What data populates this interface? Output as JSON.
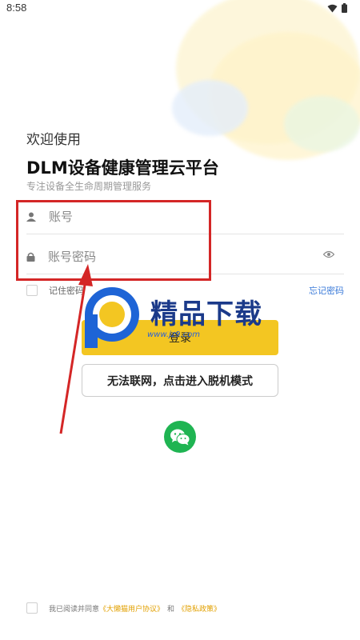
{
  "status_bar": {
    "time": "8:58"
  },
  "header": {
    "welcome": "欢迎使用",
    "title": "DLM设备健康管理云平台",
    "subtitle": "专注设备全生命周期管理服务"
  },
  "form": {
    "account_placeholder": "账号",
    "password_placeholder": "账号密码",
    "remember_label": "记住密码",
    "forgot_label": "忘记密码",
    "login_label": "登录",
    "offline_label": "无法联网，点击进入脱机模式"
  },
  "agreement": {
    "prefix": "我已阅读并同意",
    "user_agreement": "《大懒猫用户协议》",
    "and": "和",
    "privacy_policy": "《隐私政策》"
  },
  "watermark": {
    "text": "精品下载",
    "url": "www.jz9.com"
  },
  "colors": {
    "accent": "#f3c622",
    "link": "#3a7ad9",
    "wechat": "#1fb452",
    "annotation": "#d42626"
  },
  "icons": [
    "wifi-icon",
    "battery-icon",
    "user-icon",
    "lock-icon",
    "eye-icon",
    "wechat-icon"
  ]
}
